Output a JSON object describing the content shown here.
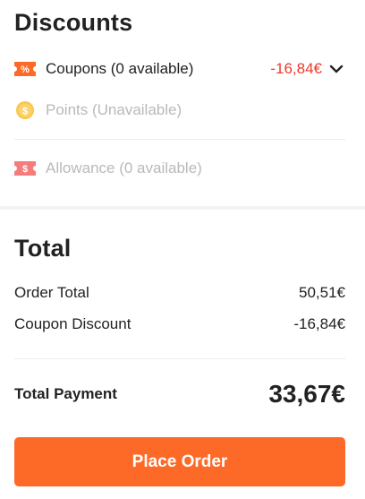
{
  "discounts": {
    "title": "Discounts",
    "coupons": {
      "label": "Coupons (0 available)",
      "amount": "-16,84€",
      "icon": "coupon-percent-icon",
      "expand_icon": "chevron-down-icon"
    },
    "points": {
      "label": "Points (Unavailable)",
      "icon": "coin-icon"
    },
    "allowance": {
      "label": "Allowance (0 available)",
      "icon": "allowance-ticket-icon"
    }
  },
  "total": {
    "title": "Total",
    "order_total_label": "Order Total",
    "order_total_value": "50,51€",
    "coupon_discount_label": "Coupon Discount",
    "coupon_discount_value": "-16,84€",
    "payment_label": "Total Payment",
    "payment_value": "33,67€"
  },
  "actions": {
    "place_order_label": "Place Order"
  },
  "colors": {
    "accent": "#fd6a27",
    "discount_red": "#ee3a2d",
    "disabled_text": "#b9b9b9",
    "coin_yellow": "#f9c74f"
  }
}
